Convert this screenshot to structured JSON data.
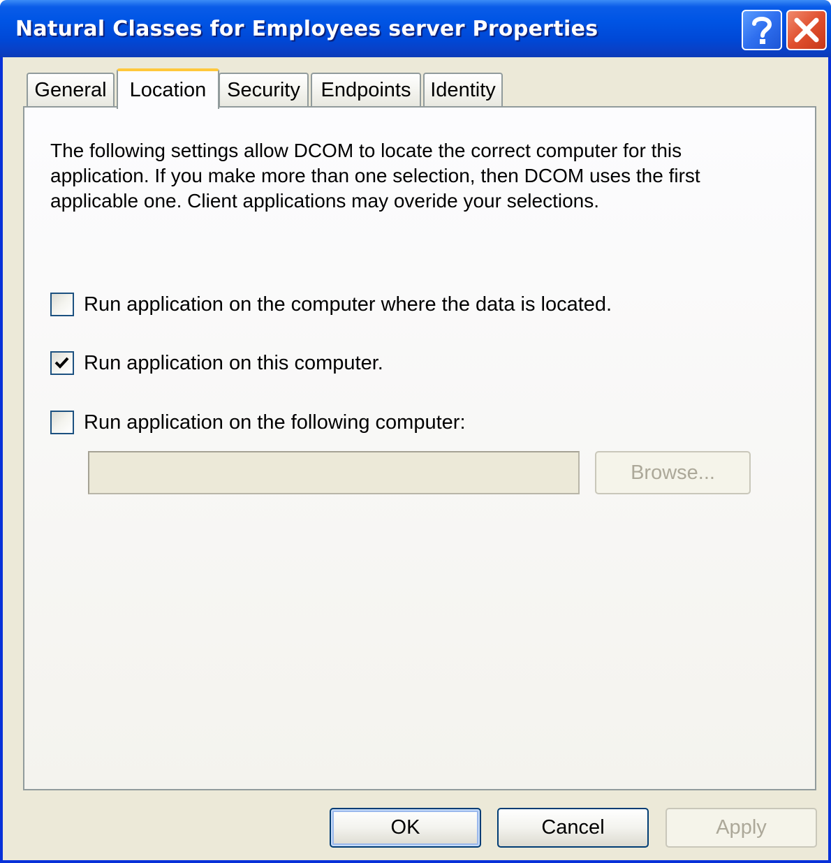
{
  "window": {
    "title": "Natural Classes for Employees server Properties",
    "help_icon": "question-mark-icon",
    "close_icon": "close-x-icon"
  },
  "tabs": [
    {
      "label": "General",
      "active": false
    },
    {
      "label": "Location",
      "active": true
    },
    {
      "label": "Security",
      "active": false
    },
    {
      "label": "Endpoints",
      "active": false
    },
    {
      "label": "Identity",
      "active": false
    }
  ],
  "location": {
    "description": "The following settings allow DCOM to locate the correct computer for this application. If you make more than one selection, then DCOM uses the first applicable one. Client applications may overide your selections.",
    "options": [
      {
        "label": "Run application on the computer where the data is located.",
        "checked": false
      },
      {
        "label": "Run application on this computer.",
        "checked": true
      },
      {
        "label": "Run application on the following computer:",
        "checked": false
      }
    ],
    "computer_field_value": "",
    "browse_label": "Browse..."
  },
  "buttons": {
    "ok_label": "OK",
    "cancel_label": "Cancel",
    "apply_label": "Apply"
  },
  "colors": {
    "titlebar_blue": "#0055e5",
    "dialog_face": "#ece9d8",
    "active_tab_highlight": "#ffc83c",
    "close_red": "#e0502e"
  }
}
